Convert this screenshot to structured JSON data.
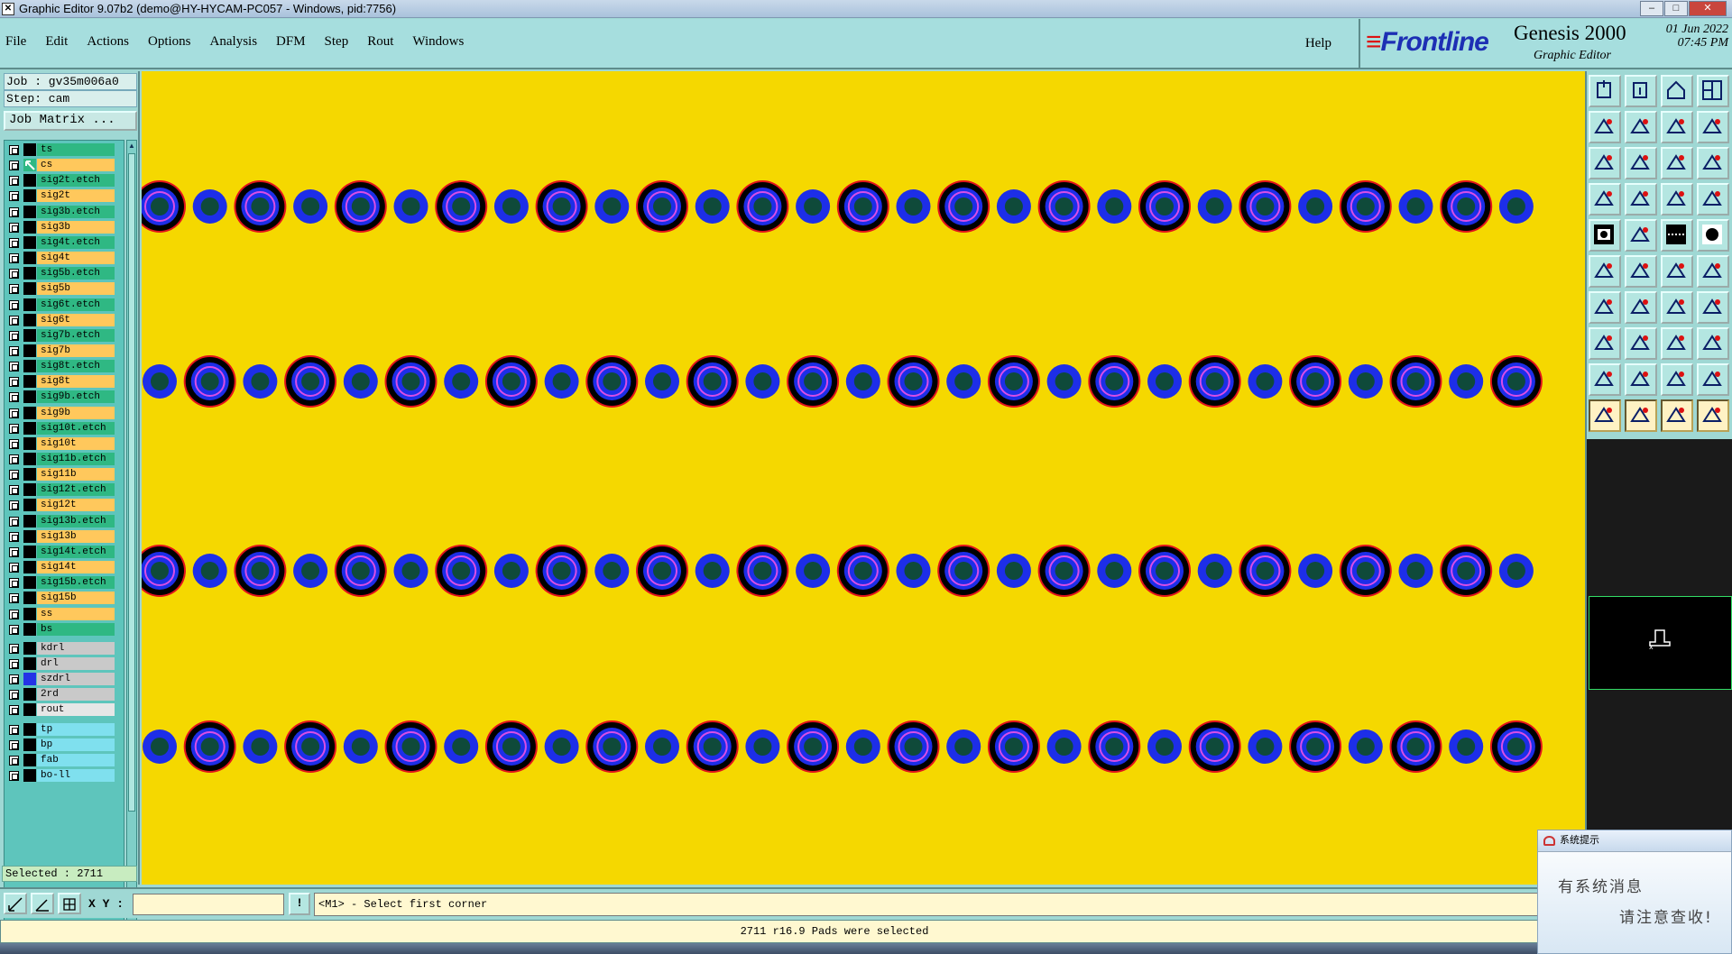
{
  "window": {
    "title": "Graphic Editor 9.07b2 (demo@HY-HYCAM-PC057 - Windows, pid:7756)",
    "buttons": [
      "minimize",
      "maximize",
      "close"
    ]
  },
  "menu": {
    "items": [
      "File",
      "Edit",
      "Actions",
      "Options",
      "Analysis",
      "DFM",
      "Step",
      "Rout",
      "Windows"
    ],
    "help": "Help"
  },
  "brand": {
    "logo": "Frontline",
    "product": "Genesis 2000",
    "subtitle": "Graphic Editor",
    "date": "01 Jun 2022",
    "time": "07:45 PM"
  },
  "job": {
    "job_line": "Job : gv35m006a0",
    "step_line": "Step: cam",
    "matrix_button": "Job Matrix ..."
  },
  "layers": [
    {
      "name": "ts",
      "color": "#2fb883",
      "swatch": "#000000"
    },
    {
      "name": "cs",
      "color": "#ffc85c",
      "swatch": "#2fb883",
      "active": true
    },
    {
      "name": "sig2t.etch",
      "color": "#2fb883",
      "swatch": "#000000"
    },
    {
      "name": "sig2t",
      "color": "#ffc85c",
      "swatch": "#000000"
    },
    {
      "name": "sig3b.etch",
      "color": "#2fb883",
      "swatch": "#000000"
    },
    {
      "name": "sig3b",
      "color": "#ffc85c",
      "swatch": "#000000"
    },
    {
      "name": "sig4t.etch",
      "color": "#2fb883",
      "swatch": "#000000"
    },
    {
      "name": "sig4t",
      "color": "#ffc85c",
      "swatch": "#000000"
    },
    {
      "name": "sig5b.etch",
      "color": "#2fb883",
      "swatch": "#000000"
    },
    {
      "name": "sig5b",
      "color": "#ffc85c",
      "swatch": "#000000"
    },
    {
      "name": "sig6t.etch",
      "color": "#2fb883",
      "swatch": "#000000"
    },
    {
      "name": "sig6t",
      "color": "#ffc85c",
      "swatch": "#000000"
    },
    {
      "name": "sig7b.etch",
      "color": "#2fb883",
      "swatch": "#000000"
    },
    {
      "name": "sig7b",
      "color": "#ffc85c",
      "swatch": "#000000"
    },
    {
      "name": "sig8t.etch",
      "color": "#2fb883",
      "swatch": "#000000"
    },
    {
      "name": "sig8t",
      "color": "#ffc85c",
      "swatch": "#000000"
    },
    {
      "name": "sig9b.etch",
      "color": "#2fb883",
      "swatch": "#000000"
    },
    {
      "name": "sig9b",
      "color": "#ffc85c",
      "swatch": "#000000"
    },
    {
      "name": "sig10t.etch",
      "color": "#2fb883",
      "swatch": "#000000"
    },
    {
      "name": "sig10t",
      "color": "#ffc85c",
      "swatch": "#000000"
    },
    {
      "name": "sig11b.etch",
      "color": "#2fb883",
      "swatch": "#000000"
    },
    {
      "name": "sig11b",
      "color": "#ffc85c",
      "swatch": "#000000"
    },
    {
      "name": "sig12t.etch",
      "color": "#2fb883",
      "swatch": "#000000"
    },
    {
      "name": "sig12t",
      "color": "#ffc85c",
      "swatch": "#000000"
    },
    {
      "name": "sig13b.etch",
      "color": "#2fb883",
      "swatch": "#000000"
    },
    {
      "name": "sig13b",
      "color": "#ffc85c",
      "swatch": "#000000"
    },
    {
      "name": "sig14t.etch",
      "color": "#2fb883",
      "swatch": "#000000"
    },
    {
      "name": "sig14t",
      "color": "#ffc85c",
      "swatch": "#000000"
    },
    {
      "name": "sig15b.etch",
      "color": "#2fb883",
      "swatch": "#000000"
    },
    {
      "name": "sig15b",
      "color": "#ffc85c",
      "swatch": "#000000"
    },
    {
      "name": "ss",
      "color": "#ffc85c",
      "swatch": "#000000"
    },
    {
      "name": "bs",
      "color": "#2fb883",
      "swatch": "#000000"
    },
    {
      "name": "kdrl",
      "color": "#c9c9c9",
      "swatch": "#000000"
    },
    {
      "name": "drl",
      "color": "#c9c9c9",
      "swatch": "#000000"
    },
    {
      "name": "szdrl",
      "color": "#c9c9c9",
      "swatch": "#2433e6"
    },
    {
      "name": "2rd",
      "color": "#c9c9c9",
      "swatch": "#000000"
    },
    {
      "name": "rout",
      "color": "#e6e6e6",
      "swatch": "#000000"
    },
    {
      "name": "tp",
      "color": "#7fe0ee",
      "swatch": "#000000"
    },
    {
      "name": "bp",
      "color": "#7fe0ee",
      "swatch": "#000000"
    },
    {
      "name": "fab",
      "color": "#7fe0ee",
      "swatch": "#000000"
    },
    {
      "name": "bo-ll",
      "color": "#7fe0ee",
      "swatch": "#000000"
    }
  ],
  "selected_status": "Selected : 2711",
  "coordinate": {
    "label": "X Y :",
    "value": "",
    "bang": "!"
  },
  "prompt": "<M1> - Select first corner",
  "status": "2711 r16.9 Pads were selected",
  "tools": [
    "zoom-home-icon",
    "zoom-out-icon",
    "home-icon",
    "window-split-icon",
    "pan-left-icon",
    "pan-right-icon",
    "redo-view-icon",
    "swap-view-icon",
    "fit-screen-icon",
    "fit-profile-icon",
    "scale-1-2-icon",
    "help-query-icon",
    "snap-icon",
    "grid-icon",
    "layer-compare-icon",
    "layer-list-icon",
    "camera-icon",
    "rotate-shape-icon",
    "measure-ruler-icon",
    "pad-dot-icon",
    "net-connect-icon",
    "cross-select-icon",
    "node-edit-icon",
    "node-arrow-icon",
    "angle-icon",
    "line-draw-icon",
    "arc-undo-icon",
    "mirror-icon",
    "box-add-icon",
    "line-minus-icon",
    "bracket-icon",
    "copy-shape-icon",
    "triangle-icon",
    "triangle-fill-icon",
    "trapezoid-icon",
    "slope-icon",
    "select-arrow-icon",
    "select-box-icon",
    "select-circle-icon",
    "select-net-icon"
  ],
  "notification": {
    "title": "系统提示",
    "line1": "有系统消息",
    "line2": "请注意查收!"
  },
  "colors": {
    "canvas": "#f5d800",
    "pad_blue": "#1d2ee8",
    "pad_center": "#0f4a3a",
    "ring_black": "#000000",
    "ring_red": "#e2141a",
    "ring_magenta": "#d94ee6",
    "panel": "#9fd8d4"
  },
  "pad_rows": {
    "count": 4,
    "pads_per_row": 28,
    "pitch_mils": 50
  }
}
